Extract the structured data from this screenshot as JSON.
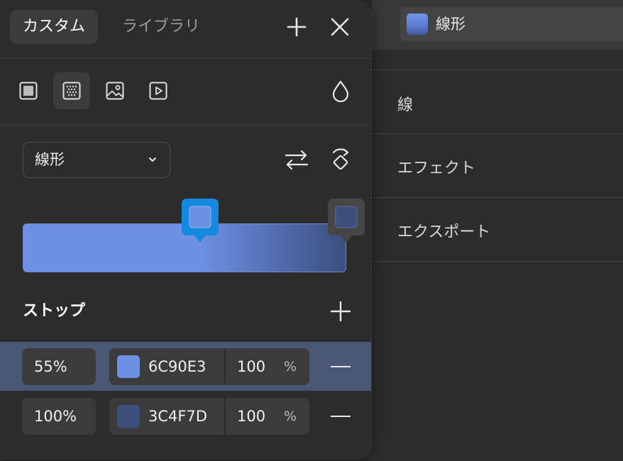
{
  "tabs": {
    "custom": "カスタム",
    "library": "ライブラリ"
  },
  "fill_type": {
    "selected": "線形",
    "options_visible": [
      "線形"
    ]
  },
  "gradient": {
    "stops_title": "ストップ",
    "stops": [
      {
        "position": "55%",
        "hex": "6C90E3",
        "color": "#6C90E3",
        "alpha": "100",
        "alpha_unit": "%",
        "selected": true
      },
      {
        "position": "100%",
        "hex": "3C4F7D",
        "color": "#3C4F7D",
        "alpha": "100",
        "alpha_unit": "%",
        "selected": false
      }
    ]
  },
  "properties": {
    "fill_label": "線形",
    "sections": [
      "線",
      "エフェクト",
      "エクスポート"
    ]
  },
  "colors": {
    "accent": "#1589e0",
    "selected_row": "#4a5775",
    "panel": "#2c2c2c"
  },
  "icons": [
    "plus-icon",
    "close-icon",
    "solid-fill-icon",
    "gradient-fill-icon",
    "image-fill-icon",
    "video-fill-icon",
    "opacity-drop-icon",
    "chevron-down-icon",
    "swap-arrows-icon",
    "rotate-gradient-icon",
    "add-stop-icon",
    "remove-stop-icon"
  ]
}
